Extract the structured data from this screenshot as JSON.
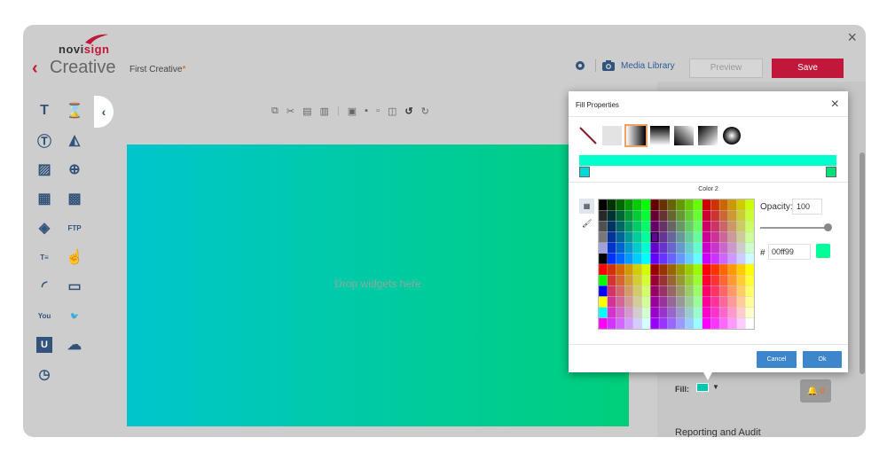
{
  "app": {
    "logo_prefix": "novi",
    "logo_suffix": "sign",
    "title": "Creative",
    "subtitle": "First Creative",
    "required_mark": "*"
  },
  "header": {
    "media_library_label": "Media Library",
    "preview_label": "Preview",
    "save_label": "Save",
    "close_label": "×"
  },
  "sidebar": {
    "collapse_label": "‹",
    "tools": [
      "text-icon",
      "hourglass-icon",
      "text-frame-icon",
      "shapes-icon",
      "image-icon",
      "globe-icon",
      "video-icon",
      "image-gallery-icon",
      "slideshow-icon",
      "ftp-icon",
      "ticker-text-icon",
      "swipe-icon",
      "rss-icon",
      "screen-icon",
      "youtube-icon",
      "twitter-icon",
      "u-icon",
      "weather-icon",
      "clock-icon"
    ]
  },
  "canvas": {
    "drop_text": "Drop widgets here",
    "gradient_start": "#00c6cc",
    "gradient_end": "#00cf7a"
  },
  "right_panel": {
    "fill_label": "Fill:",
    "reporting_label": "Reporting and Audit"
  },
  "notifications": {
    "count": "0"
  },
  "fill_properties": {
    "title": "Fill Properties",
    "close_label": "×",
    "color_label": "Color 2",
    "opacity_label": "Opacity:",
    "opacity_value": "100",
    "hash_label": "#",
    "hex_value": "00ff99",
    "selected_color": "#00ff99",
    "cancel_label": "Cancel",
    "ok_label": "Ok"
  }
}
